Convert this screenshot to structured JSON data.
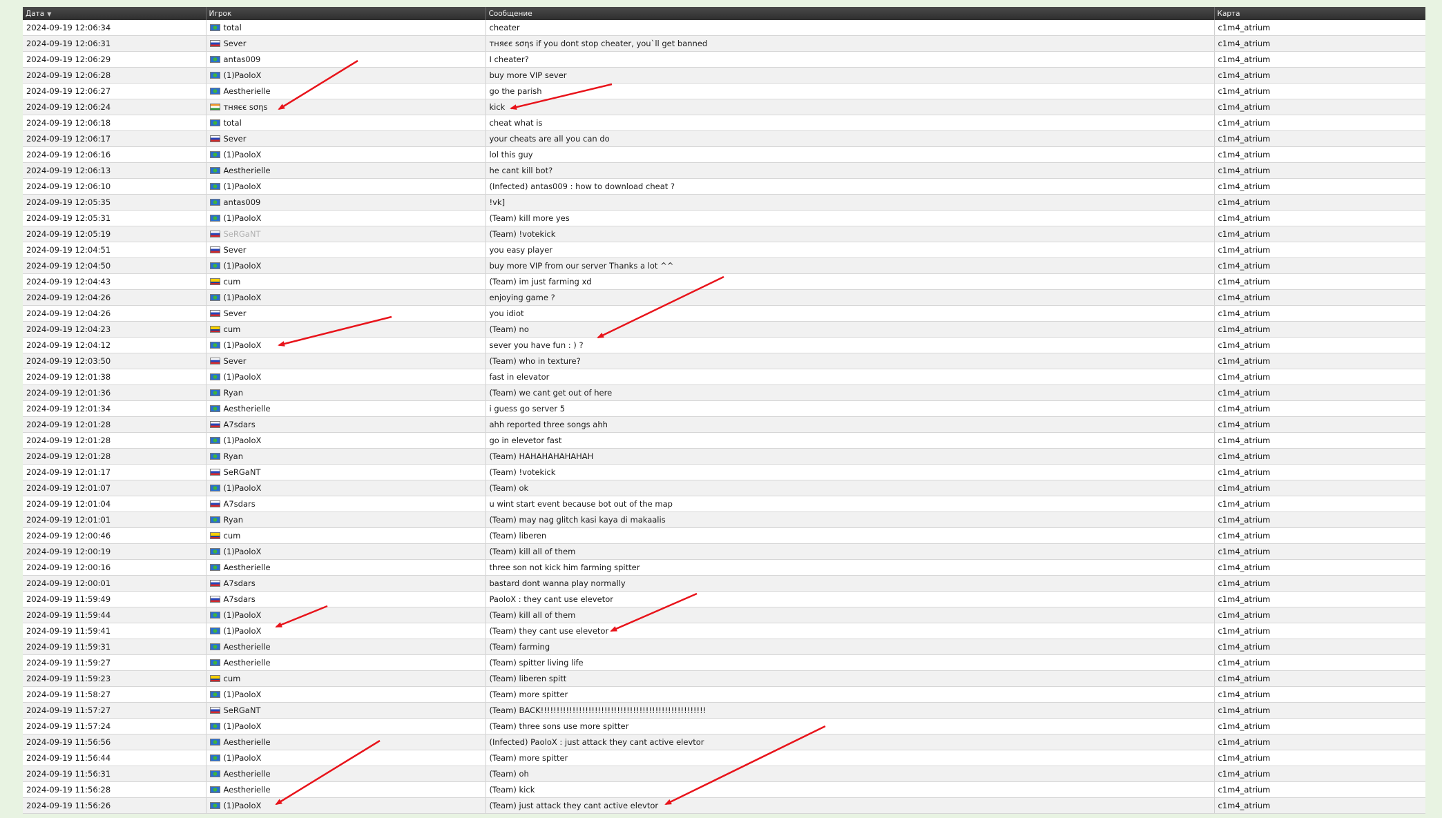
{
  "table": {
    "headers": {
      "date": "Дата",
      "player": "Игрок",
      "message": "Сообщение",
      "map": "Карта"
    },
    "sort_indicator": "▼",
    "rows": [
      {
        "date": "2024-09-19 12:06:34",
        "flag": "world",
        "player": "total",
        "message": "cheater",
        "map": "c1m4_atrium"
      },
      {
        "date": "2024-09-19 12:06:31",
        "flag": "ru",
        "player": "Sever",
        "message": "тняєє ѕσηѕ if you dont stop cheater, you`ll get banned",
        "map": "c1m4_atrium"
      },
      {
        "date": "2024-09-19 12:06:29",
        "flag": "world",
        "player": "antas009",
        "message": "I cheater?",
        "map": "c1m4_atrium"
      },
      {
        "date": "2024-09-19 12:06:28",
        "flag": "world",
        "player": "(1)PaoloX",
        "message": "buy more VIP sever",
        "map": "c1m4_atrium"
      },
      {
        "date": "2024-09-19 12:06:27",
        "flag": "world",
        "player": "Aestherielle",
        "message": "go the parish",
        "map": "c1m4_atrium"
      },
      {
        "date": "2024-09-19 12:06:24",
        "flag": "in",
        "player": "тняєє ѕσηѕ",
        "message": "kick",
        "map": "c1m4_atrium"
      },
      {
        "date": "2024-09-19 12:06:18",
        "flag": "world",
        "player": "total",
        "message": "cheat what is",
        "map": "c1m4_atrium"
      },
      {
        "date": "2024-09-19 12:06:17",
        "flag": "ru",
        "player": "Sever",
        "message": "your cheats are all you can do",
        "map": "c1m4_atrium"
      },
      {
        "date": "2024-09-19 12:06:16",
        "flag": "world",
        "player": "(1)PaoloX",
        "message": "lol this guy",
        "map": "c1m4_atrium"
      },
      {
        "date": "2024-09-19 12:06:13",
        "flag": "world",
        "player": "Aestherielle",
        "message": "he cant kill bot?",
        "map": "c1m4_atrium"
      },
      {
        "date": "2024-09-19 12:06:10",
        "flag": "world",
        "player": "(1)PaoloX",
        "message": "(Infected) antas009 : how to download cheat ?",
        "map": "c1m4_atrium"
      },
      {
        "date": "2024-09-19 12:05:35",
        "flag": "world",
        "player": "antas009",
        "message": "!vk]",
        "map": "c1m4_atrium"
      },
      {
        "date": "2024-09-19 12:05:31",
        "flag": "world",
        "player": "(1)PaoloX",
        "message": "(Team) kill more yes",
        "map": "c1m4_atrium"
      },
      {
        "date": "2024-09-19 12:05:19",
        "flag": "ru",
        "player": "SeRGaNT",
        "message": "(Team) !votekick",
        "map": "c1m4_atrium",
        "dim": true
      },
      {
        "date": "2024-09-19 12:04:51",
        "flag": "ru",
        "player": "Sever",
        "message": "you easy player",
        "map": "c1m4_atrium"
      },
      {
        "date": "2024-09-19 12:04:50",
        "flag": "world",
        "player": "(1)PaoloX",
        "message": "buy more VIP from our server Thanks a lot ^^",
        "map": "c1m4_atrium"
      },
      {
        "date": "2024-09-19 12:04:43",
        "flag": "co",
        "player": "cum",
        "message": "(Team) im just farming xd",
        "map": "c1m4_atrium"
      },
      {
        "date": "2024-09-19 12:04:26",
        "flag": "world",
        "player": "(1)PaoloX",
        "message": "enjoying game ?",
        "map": "c1m4_atrium"
      },
      {
        "date": "2024-09-19 12:04:26",
        "flag": "ru",
        "player": "Sever",
        "message": "you idiot",
        "map": "c1m4_atrium"
      },
      {
        "date": "2024-09-19 12:04:23",
        "flag": "co",
        "player": "cum",
        "message": "(Team) no",
        "map": "c1m4_atrium"
      },
      {
        "date": "2024-09-19 12:04:12",
        "flag": "world",
        "player": "(1)PaoloX",
        "message": "sever you have fun : ) ?",
        "map": "c1m4_atrium"
      },
      {
        "date": "2024-09-19 12:03:50",
        "flag": "ru",
        "player": "Sever",
        "message": "(Team) who in texture?",
        "map": "c1m4_atrium"
      },
      {
        "date": "2024-09-19 12:01:38",
        "flag": "world",
        "player": "(1)PaoloX",
        "message": "fast in elevator",
        "map": "c1m4_atrium"
      },
      {
        "date": "2024-09-19 12:01:36",
        "flag": "world",
        "player": "Ryan",
        "message": "(Team) we cant get out of here",
        "map": "c1m4_atrium"
      },
      {
        "date": "2024-09-19 12:01:34",
        "flag": "world",
        "player": "Aestherielle",
        "message": "i guess go server 5",
        "map": "c1m4_atrium"
      },
      {
        "date": "2024-09-19 12:01:28",
        "flag": "ru",
        "player": "A7sdars",
        "message": "ahh reported three songs ahh",
        "map": "c1m4_atrium"
      },
      {
        "date": "2024-09-19 12:01:28",
        "flag": "world",
        "player": "(1)PaoloX",
        "message": "go in elevetor fast",
        "map": "c1m4_atrium"
      },
      {
        "date": "2024-09-19 12:01:28",
        "flag": "world",
        "player": "Ryan",
        "message": "(Team) HAHAHAHAHAHAH",
        "map": "c1m4_atrium"
      },
      {
        "date": "2024-09-19 12:01:17",
        "flag": "ru",
        "player": "SeRGaNT",
        "message": "(Team) !votekick",
        "map": "c1m4_atrium"
      },
      {
        "date": "2024-09-19 12:01:07",
        "flag": "world",
        "player": "(1)PaoloX",
        "message": "(Team) ok",
        "map": "c1m4_atrium"
      },
      {
        "date": "2024-09-19 12:01:04",
        "flag": "ru",
        "player": "A7sdars",
        "message": "u wint start event because bot out of the map",
        "map": "c1m4_atrium"
      },
      {
        "date": "2024-09-19 12:01:01",
        "flag": "world",
        "player": "Ryan",
        "message": "(Team) may nag glitch kasi kaya di makaalis",
        "map": "c1m4_atrium"
      },
      {
        "date": "2024-09-19 12:00:46",
        "flag": "co",
        "player": "cum",
        "message": "(Team) liberen",
        "map": "c1m4_atrium"
      },
      {
        "date": "2024-09-19 12:00:19",
        "flag": "world",
        "player": "(1)PaoloX",
        "message": "(Team) kill all of them",
        "map": "c1m4_atrium"
      },
      {
        "date": "2024-09-19 12:00:16",
        "flag": "world",
        "player": "Aestherielle",
        "message": "three son not kick him farming spitter",
        "map": "c1m4_atrium"
      },
      {
        "date": "2024-09-19 12:00:01",
        "flag": "ru",
        "player": "A7sdars",
        "message": "bastard dont wanna play normally",
        "map": "c1m4_atrium"
      },
      {
        "date": "2024-09-19 11:59:49",
        "flag": "ru",
        "player": "A7sdars",
        "message": "PaoloX : they cant use elevetor",
        "map": "c1m4_atrium"
      },
      {
        "date": "2024-09-19 11:59:44",
        "flag": "world",
        "player": "(1)PaoloX",
        "message": "(Team) kill all of them",
        "map": "c1m4_atrium"
      },
      {
        "date": "2024-09-19 11:59:41",
        "flag": "world",
        "player": "(1)PaoloX",
        "message": "(Team) they cant use elevetor",
        "map": "c1m4_atrium"
      },
      {
        "date": "2024-09-19 11:59:31",
        "flag": "world",
        "player": "Aestherielle",
        "message": "(Team) farming",
        "map": "c1m4_atrium"
      },
      {
        "date": "2024-09-19 11:59:27",
        "flag": "world",
        "player": "Aestherielle",
        "message": "(Team) spitter living life",
        "map": "c1m4_atrium"
      },
      {
        "date": "2024-09-19 11:59:23",
        "flag": "co",
        "player": "cum",
        "message": "(Team) liberen spitt",
        "map": "c1m4_atrium"
      },
      {
        "date": "2024-09-19 11:58:27",
        "flag": "world",
        "player": "(1)PaoloX",
        "message": "(Team) more spitter",
        "map": "c1m4_atrium"
      },
      {
        "date": "2024-09-19 11:57:27",
        "flag": "ru",
        "player": "SeRGaNT",
        "message": "(Team) BACK!!!!!!!!!!!!!!!!!!!!!!!!!!!!!!!!!!!!!!!!!!!!!!!!!!!!",
        "map": "c1m4_atrium"
      },
      {
        "date": "2024-09-19 11:57:24",
        "flag": "world",
        "player": "(1)PaoloX",
        "message": "(Team) three sons use more spitter",
        "map": "c1m4_atrium"
      },
      {
        "date": "2024-09-19 11:56:56",
        "flag": "world",
        "player": "Aestherielle",
        "message": "(Infected) PaoloX : just attack they cant active elevtor",
        "map": "c1m4_atrium"
      },
      {
        "date": "2024-09-19 11:56:44",
        "flag": "world",
        "player": "(1)PaoloX",
        "message": "(Team) more spitter",
        "map": "c1m4_atrium"
      },
      {
        "date": "2024-09-19 11:56:31",
        "flag": "world",
        "player": "Aestherielle",
        "message": "(Team) oh",
        "map": "c1m4_atrium"
      },
      {
        "date": "2024-09-19 11:56:28",
        "flag": "world",
        "player": "Aestherielle",
        "message": "(Team) kick",
        "map": "c1m4_atrium"
      },
      {
        "date": "2024-09-19 11:56:26",
        "flag": "world",
        "player": "(1)PaoloX",
        "message": "(Team) just attack they cant active elevtor",
        "map": "c1m4_atrium"
      }
    ]
  },
  "annotation_color": "#e8141b"
}
